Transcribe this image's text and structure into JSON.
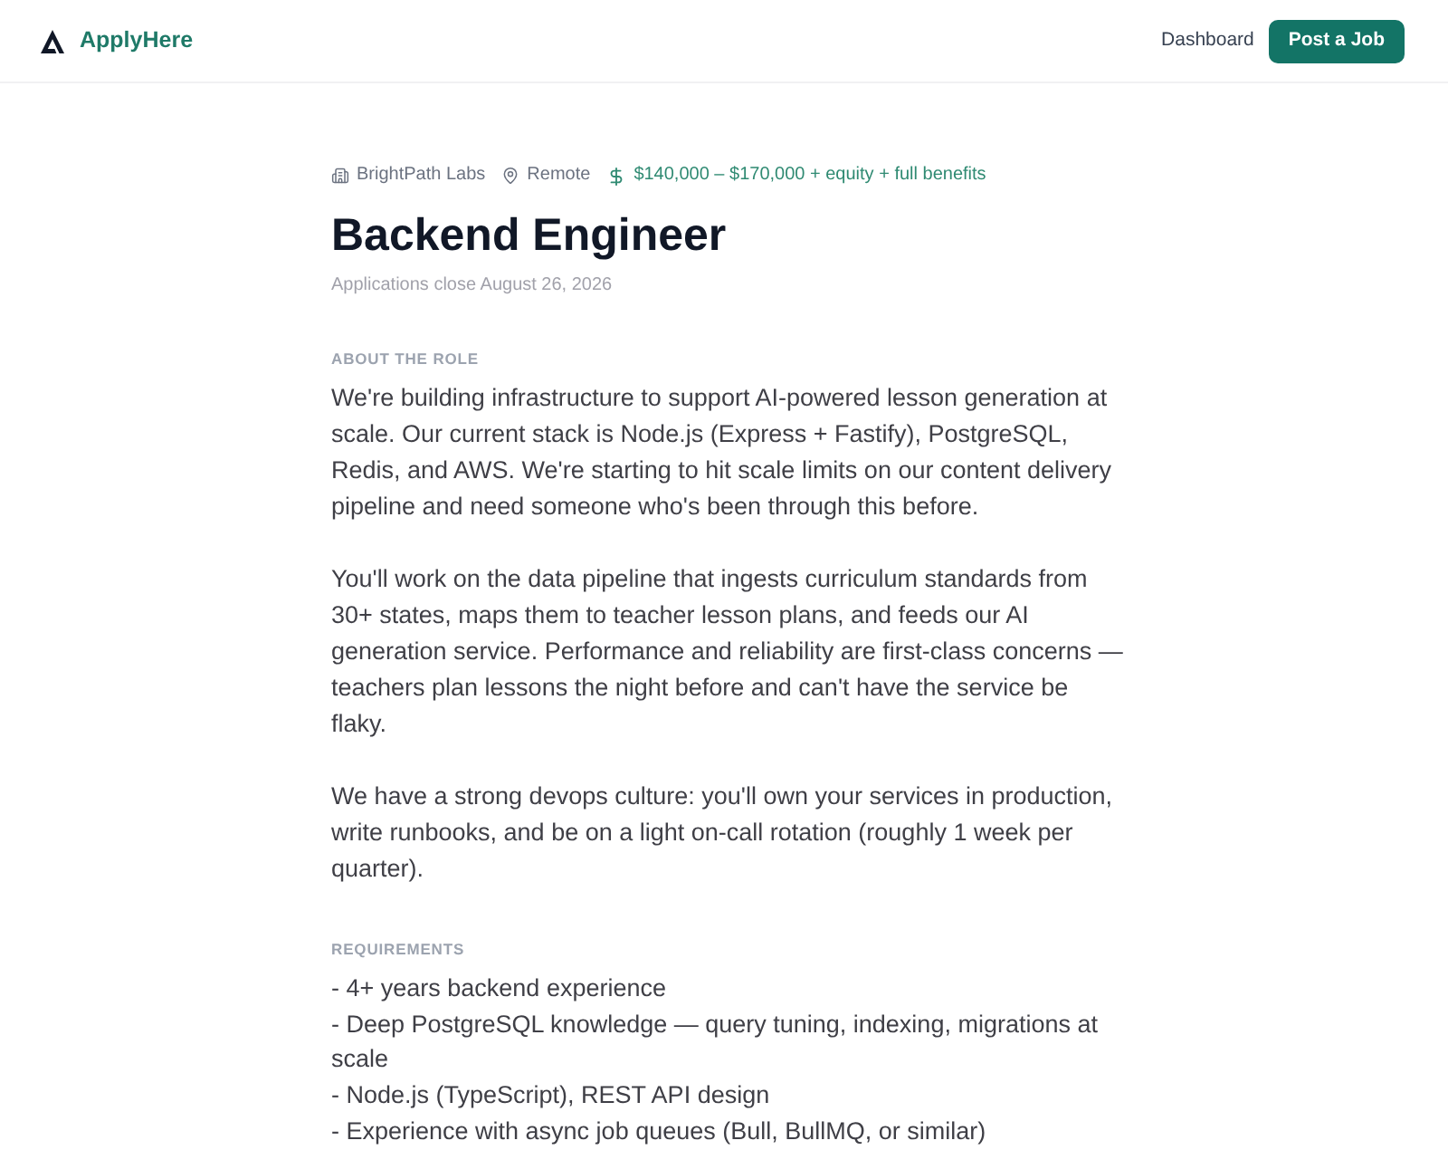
{
  "header": {
    "brand": "ApplyHere",
    "nav_link": "Dashboard",
    "button": "Post a Job"
  },
  "job": {
    "company": "BrightPath Labs",
    "location": "Remote",
    "salary": "$140,000 – $170,000 + equity + full benefits",
    "title": "Backend Engineer",
    "deadline": "Applications close August 26, 2026"
  },
  "sections": [
    {
      "kind": "paragraphs",
      "heading": "ABOUT THE ROLE",
      "paragraphs": [
        "We're building infrastructure to support AI-powered lesson generation at scale. Our current stack is Node.js (Express + Fastify), PostgreSQL, Redis, and AWS. We're starting to hit scale limits on our content delivery pipeline and need someone who's been through this before.",
        "You'll work on the data pipeline that ingests curriculum standards from 30+ states, maps them to teacher lesson plans, and feeds our AI generation service. Performance and reliability are first-class concerns — teachers plan lessons the night before and can't have the service be flaky.",
        "We have a strong devops culture: you'll own your services in production, write runbooks, and be on a light on-call rotation (roughly 1 week per quarter)."
      ]
    },
    {
      "kind": "lines",
      "heading": "REQUIREMENTS",
      "lines": [
        "- 4+ years backend experience",
        "- Deep PostgreSQL knowledge — query tuning, indexing, migrations at scale",
        "- Node.js (TypeScript), REST API design",
        "- Experience with async job queues (Bull, BullMQ, or similar)"
      ]
    }
  ]
}
